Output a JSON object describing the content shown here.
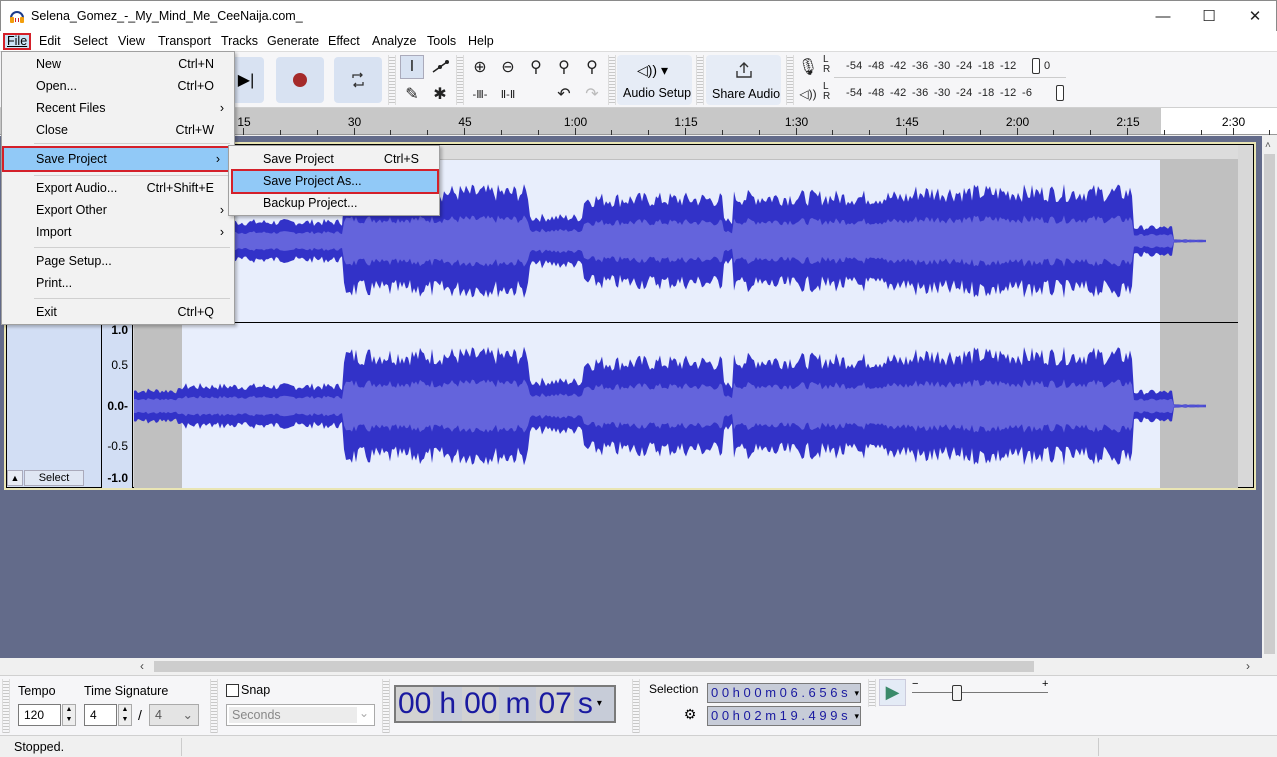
{
  "window": {
    "title": "Selena_Gomez_-_My_Mind_Me_CeeNaija.com_",
    "minimize": "—",
    "maximize": "☐",
    "close": "✕"
  },
  "menubar": {
    "items": [
      {
        "label": "File",
        "mnemonic": "F"
      },
      {
        "label": "Edit",
        "mnemonic": "E"
      },
      {
        "label": "Select",
        "mnemonic": "S"
      },
      {
        "label": "View",
        "mnemonic": "V"
      },
      {
        "label": "Transport",
        "mnemonic": "n"
      },
      {
        "label": "Tracks",
        "mnemonic": "T"
      },
      {
        "label": "Generate",
        "mnemonic": "G"
      },
      {
        "label": "Effect",
        "mnemonic": "c"
      },
      {
        "label": "Analyze",
        "mnemonic": "A"
      },
      {
        "label": "Tools",
        "mnemonic": "o"
      },
      {
        "label": "Help",
        "mnemonic": "H"
      }
    ]
  },
  "file_menu": {
    "items": [
      {
        "label": "New",
        "shortcut": "Ctrl+N"
      },
      {
        "label": "Open...",
        "shortcut": "Ctrl+O"
      },
      {
        "label": "Recent Files",
        "submenu": true
      },
      {
        "label": "Close",
        "shortcut": "Ctrl+W"
      },
      {
        "label": "Save Project",
        "submenu": true,
        "highlighted": true
      },
      {
        "label": "Export Audio...",
        "shortcut": "Ctrl+Shift+E"
      },
      {
        "label": "Export Other",
        "submenu": true
      },
      {
        "label": "Import",
        "submenu": true
      },
      {
        "label": "Page Setup..."
      },
      {
        "label": "Print..."
      },
      {
        "label": "Exit",
        "shortcut": "Ctrl+Q"
      }
    ],
    "submenu_arrow": "›"
  },
  "save_submenu": {
    "items": [
      {
        "label": "Save Project",
        "shortcut": "Ctrl+S"
      },
      {
        "label": "Save Project As...",
        "highlighted": true
      },
      {
        "label": "Backup Project..."
      }
    ]
  },
  "toolbar": {
    "audio_setup_label": "Audio Setup",
    "share_audio_label": "Share Audio",
    "meter_scale": [
      "-54",
      "-48",
      "-42",
      "-36",
      "-30",
      "-24",
      "-18",
      "-12",
      "",
      "0"
    ],
    "meter_scale_play": [
      "-54",
      "-48",
      "-42",
      "-36",
      "-30",
      "-24",
      "-18",
      "-12",
      "-6",
      ""
    ],
    "channel_l": "L",
    "channel_r": "R"
  },
  "ruler": {
    "ticks": [
      "15",
      "30",
      "45",
      "1:00",
      "1:15",
      "1:30",
      "1:45",
      "2:00",
      "2:15",
      "2:30"
    ]
  },
  "track": {
    "select_label": "Select",
    "collapse_icon": "▲",
    "scale_labels": [
      "1.0",
      "0.5",
      "0.0-",
      "-0.5",
      "-1.0"
    ]
  },
  "bottom": {
    "tempo_label": "Tempo",
    "tempo_value": "120",
    "time_signature_label": "Time Signature",
    "time_sig_num": "4",
    "time_sig_sep": "/",
    "time_sig_den": "4",
    "snap_label": "Snap",
    "snap_checked": false,
    "snap_unit": "Seconds",
    "time_display": {
      "h": "00",
      "hl": "h",
      "m": "00",
      "ml": "m",
      "s": "07",
      "sl": "s"
    },
    "selection_label": "Selection",
    "selection_start": "0 0 h 0 0 m 0 6 . 6 5 6 s",
    "selection_end": "0 0 h 0 2 m 1 9 . 4 9 9 s",
    "speed_minus": "−",
    "speed_plus": "+",
    "speed_fraction": 0.33
  },
  "status": {
    "text": "Stopped."
  }
}
